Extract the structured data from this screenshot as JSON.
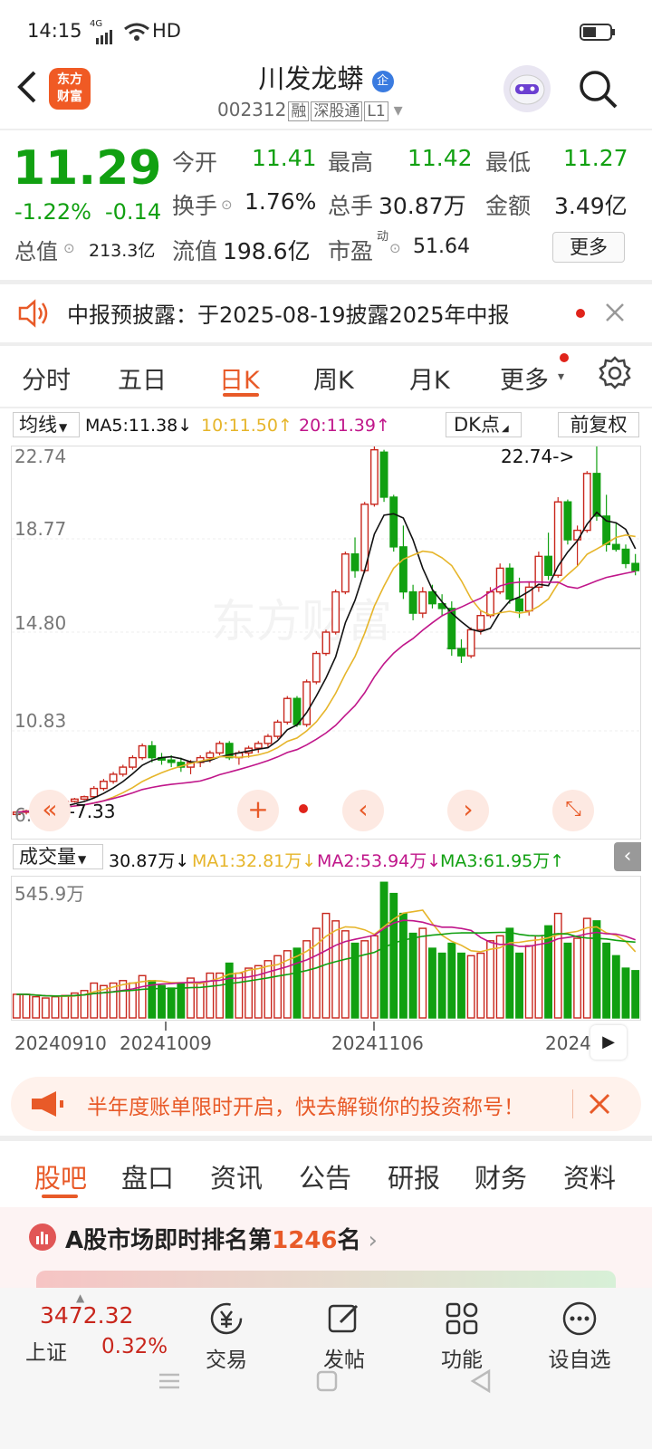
{
  "status": {
    "time": "14:15",
    "net": "4G",
    "hd": "HD"
  },
  "header": {
    "name": "川发龙蟒",
    "badge": "企",
    "code": "002312",
    "tags": [
      "融",
      "深股通",
      "L1"
    ],
    "logo_l1": "东方",
    "logo_l2": "财富"
  },
  "quote": {
    "price": "11.29",
    "pct": "-1.22%",
    "chg": "-0.14",
    "r1": [
      [
        "今开",
        "11.41"
      ],
      [
        "最高",
        "11.42"
      ],
      [
        "最低",
        "11.27"
      ]
    ],
    "r2": [
      [
        "换手",
        "1.76%"
      ],
      [
        "总手",
        "30.87万"
      ],
      [
        "金额",
        "3.49亿"
      ]
    ],
    "zz_label": "总值",
    "zz_val": "213.3亿",
    "lz_label": "流值",
    "lz_val": "198.6亿",
    "sy_label": "市盈",
    "sy_sup": "动",
    "sy_val": "51.64",
    "more": "更多"
  },
  "notice": {
    "text": "中报预披露：于2025-08-19披露2025年中报"
  },
  "tabs": [
    "分时",
    "五日",
    "日K",
    "周K",
    "月K",
    "更多"
  ],
  "ma": {
    "sel": "均线",
    "ma5": "MA5:11.38↓",
    "ma10": "10:11.50↑",
    "ma20": "20:11.39↑",
    "dk": "DK点",
    "fq": "前复权"
  },
  "chart": {
    "y_labels": [
      "22.74",
      "18.77",
      "14.80",
      "10.83",
      "6.87"
    ],
    "max_tag": "22.74->",
    "min_tag": "<-7.33",
    "watermark": "东方财富"
  },
  "vol": {
    "sel": "成交量",
    "v": "30.87万↓",
    "ma1": "MA1:32.81万↓",
    "ma2": "MA2:53.94万↓",
    "ma3": "MA3:61.95万↑",
    "ymax": "545.9万"
  },
  "dates": [
    "20240910",
    "20241009",
    "20241106",
    "2024"
  ],
  "banner": {
    "text": "半年度账单限时开启，快去解锁你的投资称号！"
  },
  "subtabs": [
    "股吧",
    "盘口",
    "资讯",
    "公告",
    "研报",
    "财务",
    "资料"
  ],
  "rank": {
    "pre": "A股市场即时排名第",
    "num": "1246",
    "post": "名"
  },
  "bottom": {
    "index": "3472.32",
    "idx_name": "上证",
    "idx_pct": "0.32%",
    "items": [
      "交易",
      "发帖",
      "功能",
      "设自选"
    ]
  },
  "colors": {
    "up": "#c8261c",
    "down": "#11a011",
    "ma5": "#111",
    "ma10": "#e6b52a",
    "ma20": "#c0168a",
    "accent": "#e85a28"
  },
  "chart_data": {
    "type": "candlestick",
    "y_range": [
      6.87,
      22.74
    ],
    "max": 22.74,
    "min": 7.33,
    "candles": [
      [
        7.2,
        7.3,
        7.1,
        7.3
      ],
      [
        7.3,
        7.4,
        7.2,
        7.35
      ],
      [
        7.35,
        7.5,
        7.3,
        7.45
      ],
      [
        7.45,
        7.6,
        7.4,
        7.55
      ],
      [
        7.55,
        7.7,
        7.5,
        7.65
      ],
      [
        7.6,
        7.8,
        7.55,
        7.75
      ],
      [
        7.75,
        7.9,
        7.7,
        7.85
      ],
      [
        7.85,
        8.0,
        7.8,
        7.95
      ],
      [
        7.95,
        8.4,
        7.9,
        8.3
      ],
      [
        8.3,
        8.7,
        8.2,
        8.6
      ],
      [
        8.6,
        9.0,
        8.5,
        8.9
      ],
      [
        8.9,
        9.3,
        8.8,
        9.2
      ],
      [
        9.2,
        9.7,
        9.1,
        9.6
      ],
      [
        9.6,
        10.2,
        9.5,
        10.1
      ],
      [
        10.1,
        10.3,
        9.4,
        9.6
      ],
      [
        9.6,
        9.8,
        9.3,
        9.5
      ],
      [
        9.5,
        9.7,
        9.2,
        9.4
      ],
      [
        9.4,
        9.6,
        9.0,
        9.2
      ],
      [
        9.2,
        9.5,
        8.9,
        9.4
      ],
      [
        9.4,
        9.7,
        9.2,
        9.6
      ],
      [
        9.6,
        9.9,
        9.4,
        9.8
      ],
      [
        9.8,
        10.3,
        9.7,
        10.2
      ],
      [
        10.2,
        10.3,
        9.5,
        9.6
      ],
      [
        9.6,
        9.9,
        9.3,
        9.8
      ],
      [
        9.8,
        10.1,
        9.6,
        10.0
      ],
      [
        10.0,
        10.3,
        9.8,
        10.2
      ],
      [
        10.2,
        10.6,
        10.0,
        10.5
      ],
      [
        10.5,
        11.2,
        10.4,
        11.1
      ],
      [
        11.1,
        12.2,
        11.0,
        12.1
      ],
      [
        12.1,
        12.2,
        10.9,
        11.0
      ],
      [
        11.0,
        12.9,
        10.9,
        12.8
      ],
      [
        12.8,
        14.1,
        12.7,
        14.0
      ],
      [
        14.0,
        15.0,
        13.9,
        14.9
      ],
      [
        14.9,
        16.7,
        14.8,
        16.6
      ],
      [
        16.6,
        18.3,
        16.5,
        18.2
      ],
      [
        18.2,
        18.9,
        17.2,
        17.5
      ],
      [
        17.5,
        20.4,
        17.4,
        20.3
      ],
      [
        20.3,
        22.74,
        20.2,
        22.6
      ],
      [
        22.5,
        22.6,
        20.4,
        20.6
      ],
      [
        20.6,
        20.7,
        18.3,
        18.5
      ],
      [
        18.5,
        19.4,
        16.3,
        16.6
      ],
      [
        16.6,
        16.9,
        15.4,
        15.7
      ],
      [
        15.7,
        16.8,
        15.5,
        16.6
      ],
      [
        16.6,
        16.9,
        15.9,
        16.1
      ],
      [
        16.1,
        16.5,
        15.6,
        15.9
      ],
      [
        15.9,
        16.2,
        13.9,
        14.2
      ],
      [
        14.2,
        14.6,
        13.6,
        13.9
      ],
      [
        13.9,
        15.1,
        13.8,
        15.0
      ],
      [
        15.0,
        15.8,
        14.8,
        15.6
      ],
      [
        15.6,
        16.8,
        15.5,
        16.6
      ],
      [
        16.6,
        17.8,
        16.5,
        17.6
      ],
      [
        17.6,
        17.8,
        16.1,
        16.3
      ],
      [
        16.3,
        17.2,
        15.5,
        15.8
      ],
      [
        15.8,
        17.0,
        15.6,
        16.8
      ],
      [
        16.8,
        18.3,
        16.6,
        18.1
      ],
      [
        18.1,
        19.1,
        17.1,
        17.3
      ],
      [
        17.3,
        20.6,
        17.2,
        20.4
      ],
      [
        20.4,
        20.5,
        18.6,
        18.8
      ],
      [
        18.8,
        19.4,
        17.7,
        19.2
      ],
      [
        19.2,
        21.7,
        19.1,
        21.6
      ],
      [
        21.6,
        22.74,
        19.6,
        19.8
      ],
      [
        19.8,
        20.7,
        18.3,
        18.6
      ],
      [
        18.6,
        19.5,
        18.3,
        18.4
      ],
      [
        18.4,
        18.6,
        17.6,
        17.8
      ],
      [
        17.8,
        18.2,
        17.3,
        17.5
      ]
    ],
    "vol_max": 545.9,
    "volumes": [
      95,
      95,
      85,
      80,
      85,
      90,
      100,
      110,
      140,
      130,
      140,
      150,
      140,
      170,
      150,
      130,
      120,
      140,
      160,
      140,
      180,
      180,
      220,
      180,
      200,
      210,
      230,
      250,
      270,
      280,
      310,
      360,
      420,
      390,
      350,
      300,
      310,
      330,
      545,
      500,
      420,
      340,
      360,
      280,
      260,
      300,
      260,
      250,
      260,
      310,
      330,
      360,
      260,
      290,
      330,
      370,
      420,
      300,
      320,
      400,
      390,
      300,
      250,
      200,
      190
    ]
  }
}
